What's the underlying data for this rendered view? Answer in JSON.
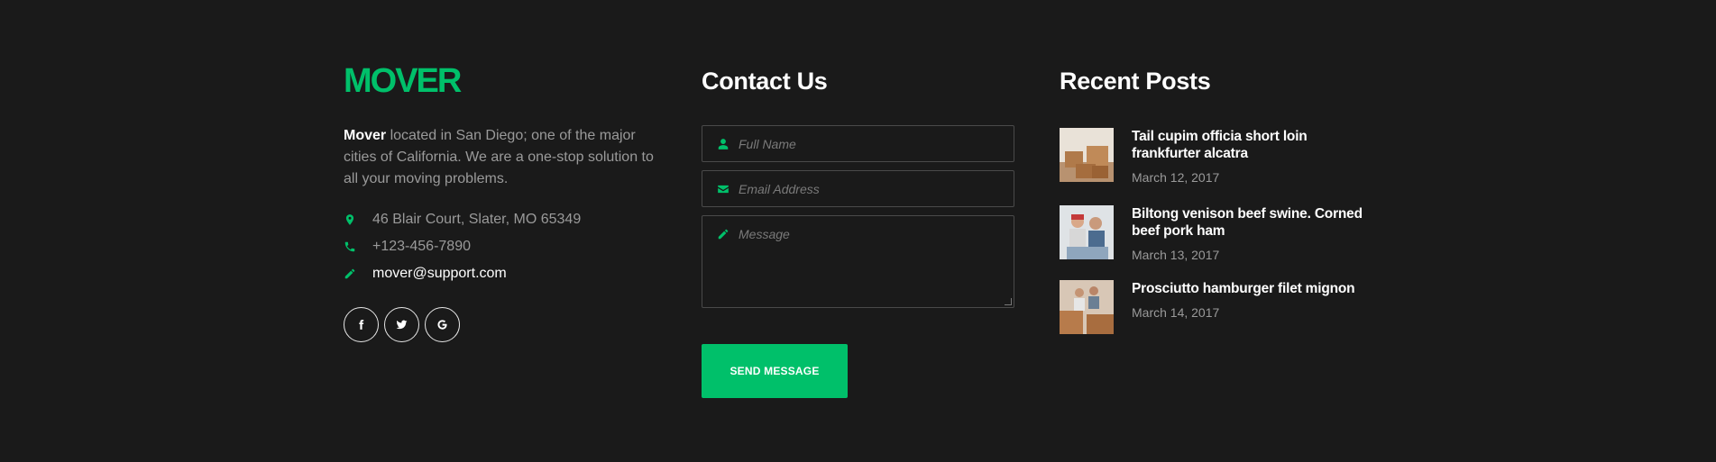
{
  "brand": {
    "logo_text": "MOVER",
    "accent_color": "#00c06a"
  },
  "about": {
    "brand_name": "Mover",
    "description": " located in San Diego; one of the major cities of California. We are a one-stop solution to all your moving problems."
  },
  "contact_info": [
    {
      "icon": "map-marker-icon",
      "text": "46 Blair Court, Slater, MO 65349"
    },
    {
      "icon": "phone-icon",
      "text": "+123-456-7890"
    },
    {
      "icon": "pencil-icon",
      "text": "mover@support.com"
    }
  ],
  "social": [
    {
      "icon": "facebook-icon"
    },
    {
      "icon": "twitter-icon"
    },
    {
      "icon": "google-icon"
    }
  ],
  "contact_form": {
    "heading": "Contact Us",
    "name_placeholder": "Full Name",
    "email_placeholder": "Email Address",
    "message_placeholder": "Message",
    "submit_label": "SEND MESSAGE"
  },
  "recent_posts": {
    "heading": "Recent Posts",
    "items": [
      {
        "title": "Tail cupim officia short loin frankfurter alcatra",
        "date": "March 12, 2017"
      },
      {
        "title": "Biltong venison beef swine. Corned beef pork ham",
        "date": "March 13, 2017"
      },
      {
        "title": "Prosciutto hamburger filet mignon",
        "date": "March 14, 2017"
      }
    ]
  }
}
